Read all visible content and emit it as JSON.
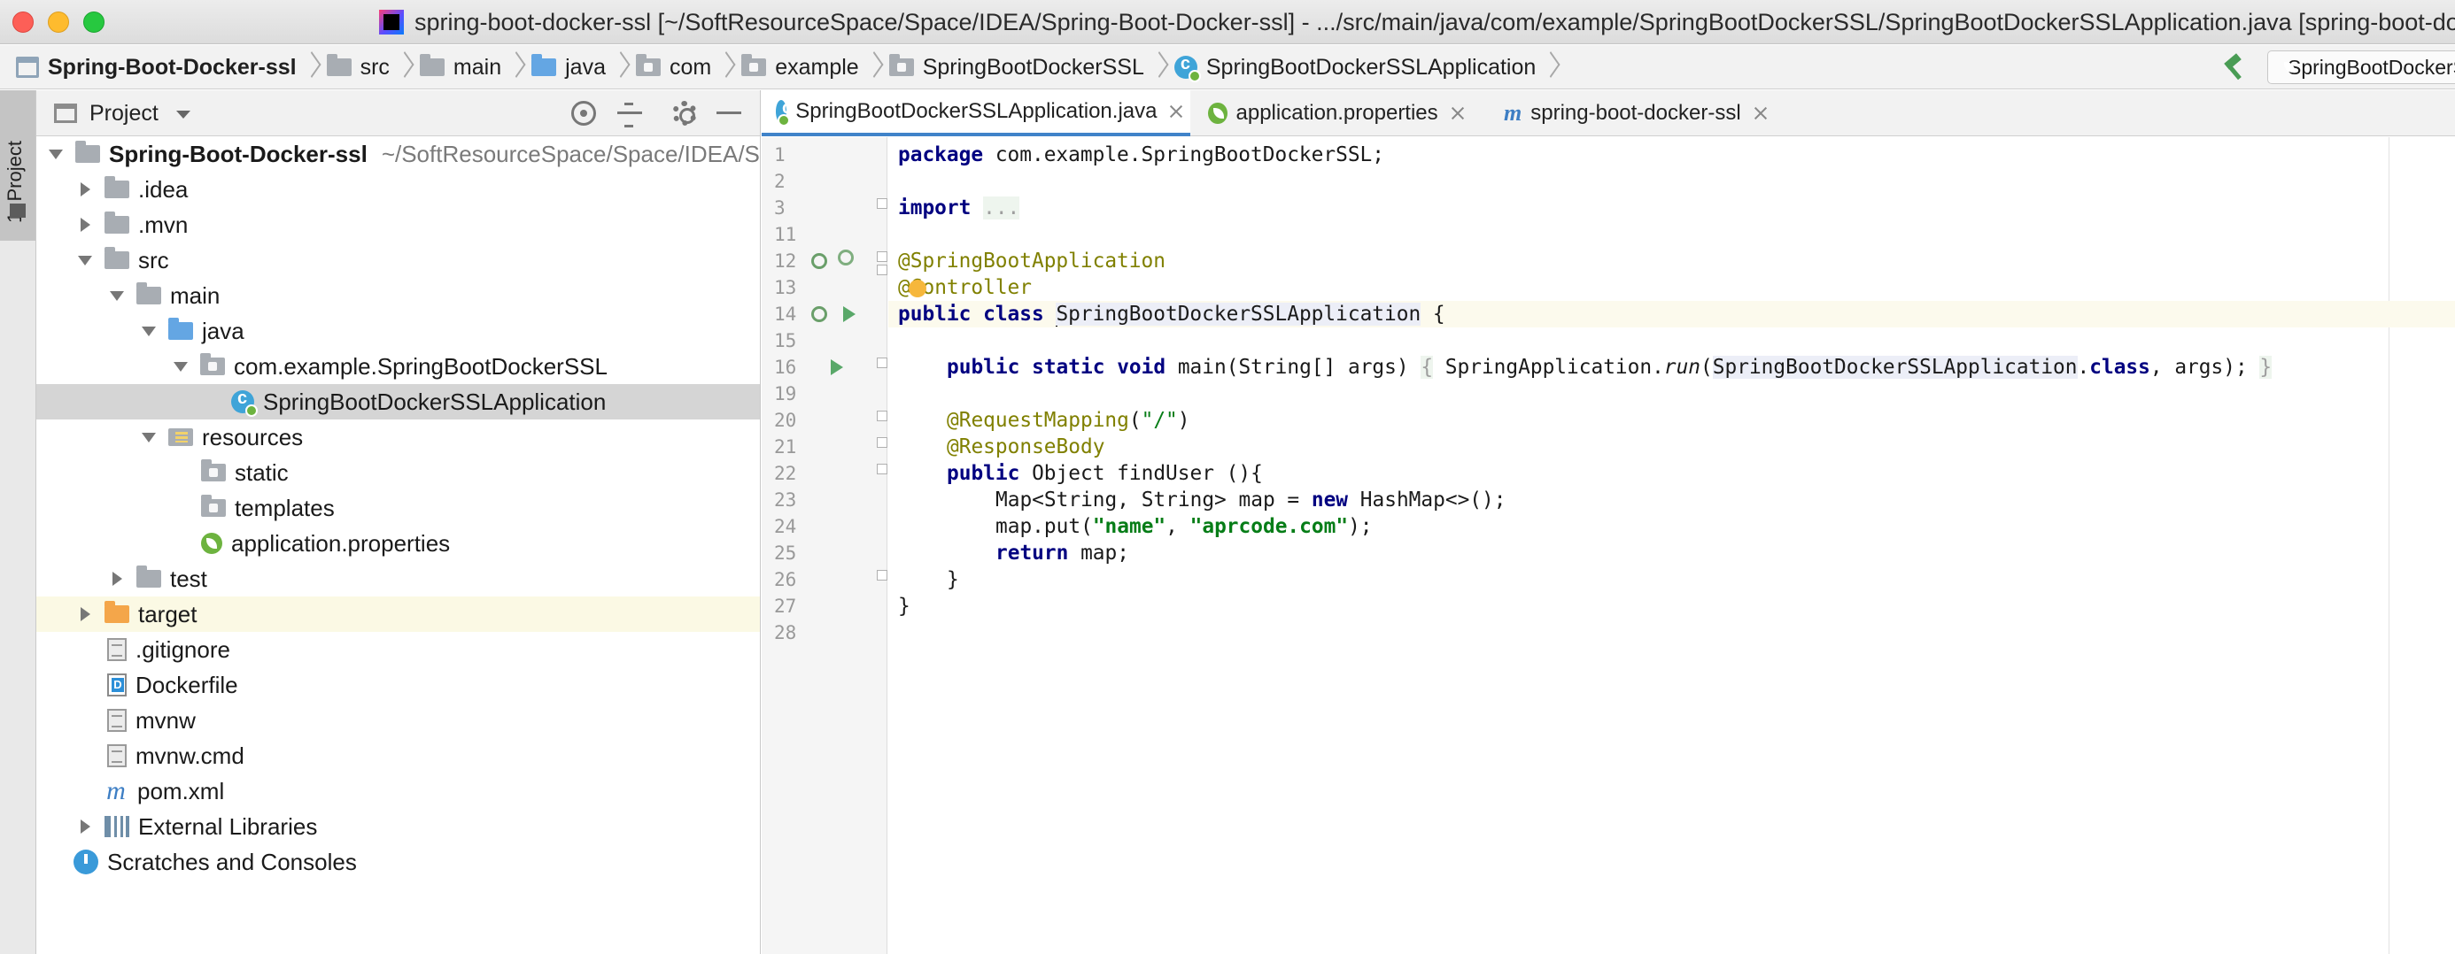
{
  "window": {
    "title": "spring-boot-docker-ssl [~/SoftResourceSpace/Space/IDEA/Spring-Boot-Docker-ssl] - .../src/main/java/com/example/SpringBootDockerSSL/SpringBootDockerSSLApplication.java [spring-boot-docker-ssl]"
  },
  "breadcrumb": [
    {
      "label": "Spring-Boot-Docker-ssl",
      "icon": "project-icon"
    },
    {
      "label": "src",
      "icon": "folder-icon"
    },
    {
      "label": "main",
      "icon": "folder-icon"
    },
    {
      "label": "java",
      "icon": "source-folder-icon"
    },
    {
      "label": "com",
      "icon": "package-icon"
    },
    {
      "label": "example",
      "icon": "package-icon"
    },
    {
      "label": "SpringBootDockerSSL",
      "icon": "package-icon"
    },
    {
      "label": "SpringBootDockerSSLApplication",
      "icon": "spring-class-icon"
    }
  ],
  "toolbar": {
    "build_icon": "hammer-icon",
    "run_config_label": "SpringBootDockerSSLApplication"
  },
  "side_strip": {
    "project_tab_label": "1: Project"
  },
  "project_panel": {
    "title": "Project",
    "tree": [
      {
        "name": "Spring-Boot-Docker-ssl",
        "path": "~/SoftResourceSpace/Space/IDEA/Spring-Boot-Docker-ssl",
        "icon": "module-folder-icon"
      },
      {
        "name": ".idea",
        "icon": "folder-icon"
      },
      {
        "name": ".mvn",
        "icon": "folder-icon"
      },
      {
        "name": "src",
        "icon": "folder-icon"
      },
      {
        "name": "main",
        "icon": "folder-icon"
      },
      {
        "name": "java",
        "icon": "source-folder-icon"
      },
      {
        "name": "com.example.SpringBootDockerSSL",
        "icon": "package-icon"
      },
      {
        "name": "SpringBootDockerSSLApplication",
        "icon": "spring-class-icon"
      },
      {
        "name": "resources",
        "icon": "resources-folder-icon"
      },
      {
        "name": "static",
        "icon": "package-icon"
      },
      {
        "name": "templates",
        "icon": "package-icon"
      },
      {
        "name": "application.properties",
        "icon": "spring-properties-icon"
      },
      {
        "name": "test",
        "icon": "folder-icon"
      },
      {
        "name": "target",
        "icon": "excluded-folder-icon"
      },
      {
        "name": ".gitignore",
        "icon": "text-file-icon"
      },
      {
        "name": "Dockerfile",
        "icon": "docker-file-icon"
      },
      {
        "name": "mvnw",
        "icon": "text-file-icon"
      },
      {
        "name": "mvnw.cmd",
        "icon": "text-file-icon"
      },
      {
        "name": "pom.xml",
        "icon": "maven-icon"
      },
      {
        "name": "External Libraries",
        "icon": "libraries-icon"
      },
      {
        "name": "Scratches and Consoles",
        "icon": "scratches-icon"
      }
    ]
  },
  "editor_tabs": [
    {
      "label": "SpringBootDockerSSLApplication.java",
      "icon": "spring-class-icon",
      "active": true
    },
    {
      "label": "application.properties",
      "icon": "spring-properties-icon",
      "active": false
    },
    {
      "label": "spring-boot-docker-ssl",
      "icon": "maven-icon",
      "active": false
    }
  ],
  "editor": {
    "line_numbers": [
      "1",
      "2",
      "3",
      "11",
      "12",
      "13",
      "14",
      "15",
      "16",
      "19",
      "20",
      "21",
      "22",
      "23",
      "24",
      "25",
      "26",
      "27",
      "28"
    ],
    "tokens": {
      "package_kw": "package",
      "package_name": "com.example.SpringBootDockerSSL;",
      "import_kw": "import",
      "import_fold": "...",
      "ann_app": "@SpringBootApplication",
      "ann_ctrl_at": "@",
      "ann_ctrl_rest": "ontroller",
      "public_kw": "public",
      "class_kw": "class",
      "class_name": "SpringBootDockerSSLApplication",
      "open_brace": " {",
      "static_kw": "static",
      "void_kw": "void",
      "main_sig": "main(String[] args) ",
      "main_body_open": "{",
      "main_body_mid": " SpringApplication.",
      "run_call": "run",
      "run_arg_class": "SpringBootDockerSSLApplication",
      "dot": ".",
      "class_lit": "class",
      "run_tail": ", args); ",
      "main_body_close": "}",
      "ann_mapping": "@RequestMapping",
      "mapping_open": "(",
      "mapping_path": "\"/\"",
      "mapping_close": ")",
      "ann_body": "@ResponseBody",
      "object_kw_rest": " Object findUser (){",
      "map_decl": "Map<String, String> map = ",
      "new_kw": "new",
      "map_new_rest": " HashMap<>();",
      "put_open": "map.put(",
      "put_key": "\"name\"",
      "put_comma": ", ",
      "put_val": "\"aprcode.com\"",
      "put_close": ");",
      "return_kw": "return",
      "return_rest": " map;",
      "close_method": "}",
      "close_class": "}"
    }
  }
}
